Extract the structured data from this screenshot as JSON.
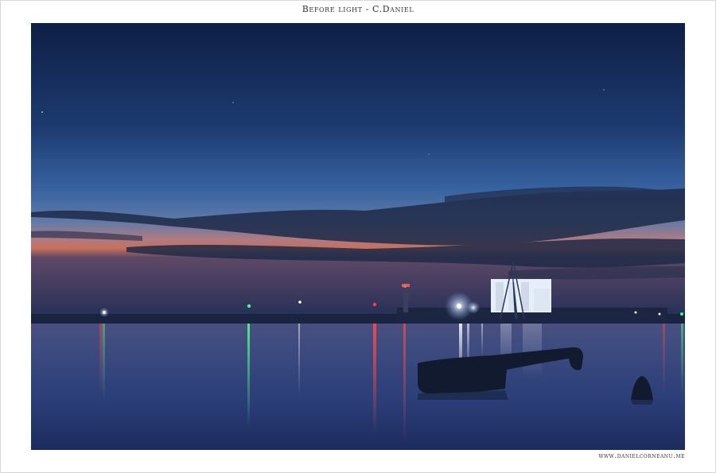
{
  "title": "Before light - C.Daniel",
  "credit": "www.danielcorneanu.me",
  "colors": {
    "sky_top": "#10224a",
    "sky_mid": "#2a5089",
    "horizon_glow": "#c8705a",
    "water": "#2c3f78",
    "harbor_light": "#e8f4ff",
    "red_light": "#ff3b3b",
    "green_light": "#3dff7a"
  }
}
